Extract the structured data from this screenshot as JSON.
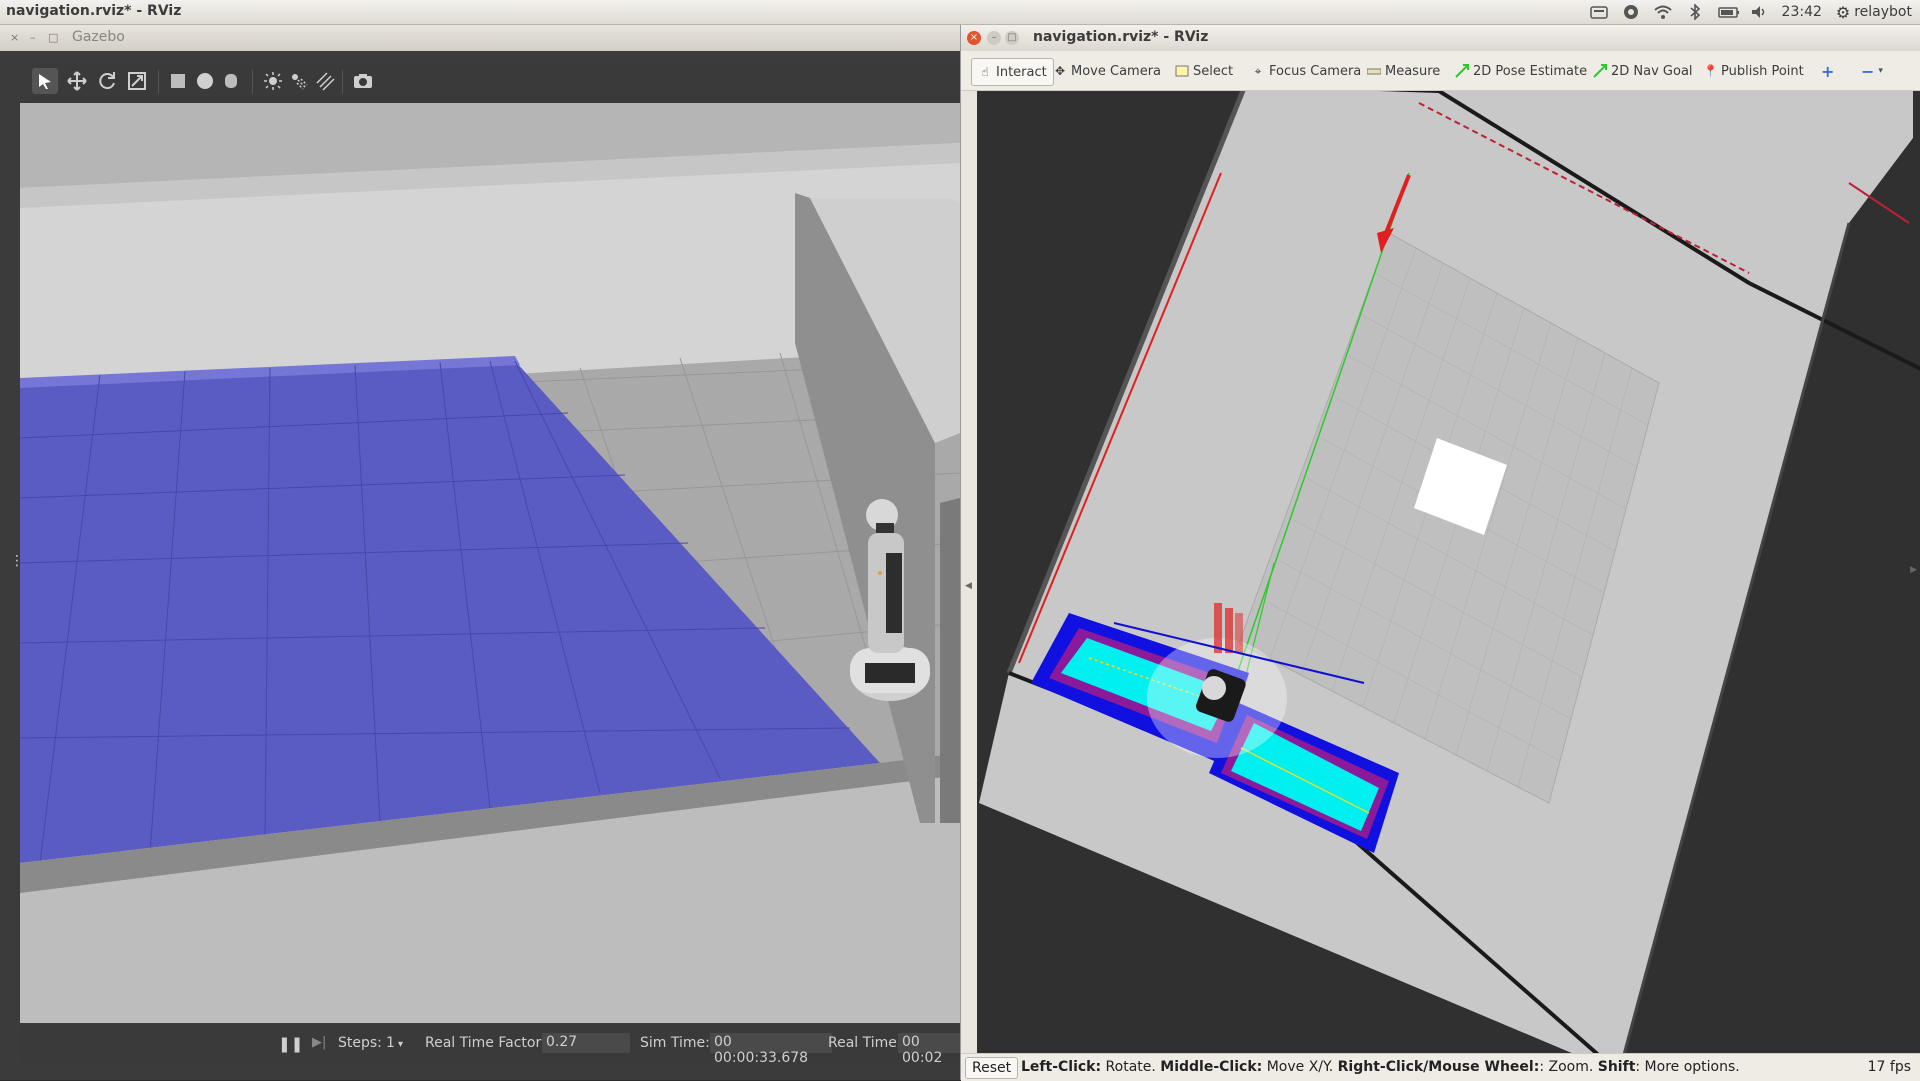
{
  "topbar": {
    "title": "navigation.rviz* - RViz",
    "time": "23:42",
    "user": "relaybot",
    "icons": [
      "keyboard-icon",
      "chrome-icon",
      "wifi-icon",
      "bluetooth-icon",
      "battery-icon",
      "volume-icon",
      "settings-gear-icon"
    ]
  },
  "gazebo": {
    "title": "Gazebo",
    "window_buttons": [
      "×",
      "–",
      "□"
    ],
    "toolbar_icons": [
      "select-arrow-icon",
      "translate-icon",
      "rotate-icon",
      "scale-icon",
      "box-shape-icon",
      "sphere-shape-icon",
      "cylinder-shape-icon",
      "point-light-icon",
      "spot-light-icon",
      "directional-light-icon",
      "screenshot-camera-icon"
    ],
    "status": {
      "pause_icon": "❚❚",
      "step_icon": "▶|",
      "steps_label": "Steps:",
      "steps_value": "1",
      "rtf_label": "Real Time Factor:",
      "rtf_value": "0.27",
      "sim_time_label": "Sim Time:",
      "sim_time_value": "00 00:00:33.678",
      "real_time_label": "Real Time:",
      "real_time_value": "00 00:02"
    },
    "colors": {
      "floor": "#5b5bc4",
      "floor_dark": "#4f4fb6",
      "wall": "#c9c9c9",
      "background": "#b8b8b8"
    }
  },
  "rviz": {
    "title": "navigation.rviz* - RViz",
    "tools": [
      {
        "label": "Interact",
        "icon": "hand-pointer-icon",
        "active": true
      },
      {
        "label": "Move Camera",
        "icon": "move-camera-icon",
        "active": false
      },
      {
        "label": "Select",
        "icon": "select-box-icon",
        "active": false
      },
      {
        "label": "Focus Camera",
        "icon": "focus-camera-icon",
        "active": false
      },
      {
        "label": "Measure",
        "icon": "ruler-icon",
        "active": false
      },
      {
        "label": "2D Pose Estimate",
        "icon": "pose-estimate-arrow-icon",
        "active": false
      },
      {
        "label": "2D Nav Goal",
        "icon": "nav-goal-arrow-icon",
        "active": false
      },
      {
        "label": "Publish Point",
        "icon": "map-pin-icon",
        "active": false
      }
    ],
    "extra_icons": [
      "add-tool-plus-icon",
      "remove-tool-minus-icon"
    ],
    "status": {
      "reset": "Reset",
      "help_left_key": "Left-Click:",
      "help_left": " Rotate. ",
      "help_middle_key": "Middle-Click:",
      "help_middle": " Move X/Y. ",
      "help_right_key": "Right-Click/Mouse Wheel:",
      "help_right": ": Zoom. ",
      "help_shift_key": "Shift",
      "help_shift": ": More options.",
      "fps": "17 fps"
    },
    "colors": {
      "map_free": "#c8c8c8",
      "cost_cyan": "#00f0f0",
      "cost_blue": "#1010e0",
      "path_green": "#2ec82e",
      "goal_red": "#e02020"
    }
  }
}
